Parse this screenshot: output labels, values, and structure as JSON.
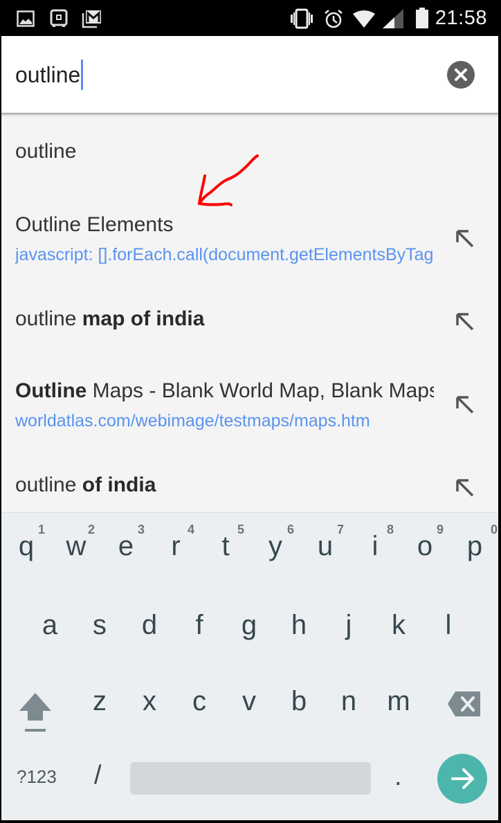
{
  "status_bar": {
    "left_icons": [
      "gallery-icon",
      "vault-icon",
      "gmail-icon"
    ],
    "right_icons": [
      "vibrate-icon",
      "alarm-icon",
      "wifi-icon",
      "signal-icon",
      "battery-icon"
    ],
    "time": "21:58"
  },
  "search": {
    "value": "outline",
    "clear_icon": "clear-icon"
  },
  "suggestions": [
    {
      "type": "query",
      "title_plain": "outline",
      "title_bold": "",
      "bold_first": false,
      "url": ""
    },
    {
      "type": "bookmark",
      "title_plain": "Outline Elements",
      "title_bold": "",
      "bold_first": false,
      "url": "javascript: [].forEach.call(document.getElementsByTagName"
    },
    {
      "type": "query",
      "title_plain": "outline ",
      "title_bold": "map of india",
      "bold_first": false,
      "url": ""
    },
    {
      "type": "site",
      "title_bold": "Outline",
      "title_plain": " Maps - Blank World Map, Blank Maps",
      "bold_first": true,
      "url": "worldatlas.com/webimage/testmaps/maps.htm"
    },
    {
      "type": "query",
      "title_plain": "outline ",
      "title_bold": "of india",
      "bold_first": false,
      "url": ""
    }
  ],
  "annotation": {
    "color": "#ff0000",
    "description": "hand-drawn arrow pointing at Outline Elements"
  },
  "keyboard": {
    "row1": [
      {
        "key": "q",
        "hint": "1"
      },
      {
        "key": "w",
        "hint": "2"
      },
      {
        "key": "e",
        "hint": "3"
      },
      {
        "key": "r",
        "hint": "4"
      },
      {
        "key": "t",
        "hint": "5"
      },
      {
        "key": "y",
        "hint": "6"
      },
      {
        "key": "u",
        "hint": "7"
      },
      {
        "key": "i",
        "hint": "8"
      },
      {
        "key": "o",
        "hint": "9"
      },
      {
        "key": "p",
        "hint": "0"
      }
    ],
    "row2": [
      "a",
      "s",
      "d",
      "f",
      "g",
      "h",
      "j",
      "k",
      "l"
    ],
    "row3": [
      "z",
      "x",
      "c",
      "v",
      "b",
      "n",
      "m"
    ],
    "symbols_label": "?123",
    "slash_label": "/",
    "period_label": ".",
    "shift_icon": "shift-icon",
    "backspace_icon": "backspace-icon",
    "enter_icon": "go-arrow-icon",
    "accent_color": "#4db6ac"
  }
}
